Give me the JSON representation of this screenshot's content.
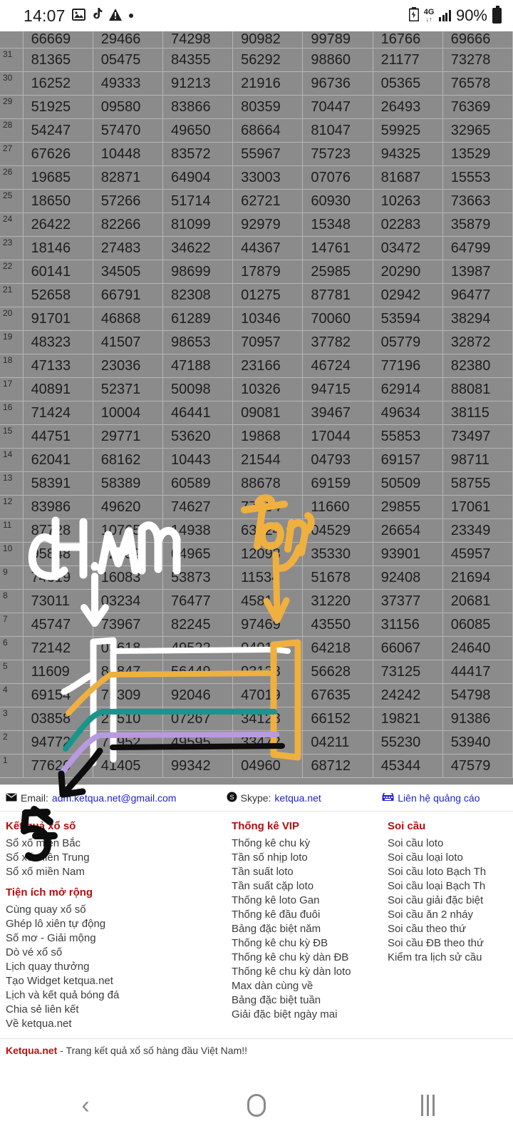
{
  "status_bar": {
    "time": "14:07",
    "icons": [
      "image-icon",
      "tiktok-icon",
      "warning-icon",
      "dot-icon"
    ],
    "battery_saver_icon": "battery-saver-icon",
    "network": "4G",
    "signal_icon": "signal-bars-icon",
    "battery_percent": "90%"
  },
  "table": {
    "columns": 7,
    "rows": [
      {
        "idx": "",
        "values": [
          "66669",
          "29466",
          "74298",
          "90982",
          "99789",
          "16766",
          "69666"
        ],
        "cut": true
      },
      {
        "idx": "31",
        "values": [
          "81365",
          "05475",
          "84355",
          "56292",
          "98860",
          "21177",
          "73278"
        ]
      },
      {
        "idx": "30",
        "values": [
          "16252",
          "49333",
          "91213",
          "21916",
          "96736",
          "05365",
          "76578"
        ]
      },
      {
        "idx": "29",
        "values": [
          "51925",
          "09580",
          "83866",
          "80359",
          "70447",
          "26493",
          "76369"
        ]
      },
      {
        "idx": "28",
        "values": [
          "54247",
          "57470",
          "49650",
          "68664",
          "81047",
          "59925",
          "32965"
        ]
      },
      {
        "idx": "27",
        "values": [
          "67626",
          "10448",
          "83572",
          "55967",
          "75723",
          "94325",
          "13529"
        ]
      },
      {
        "idx": "26",
        "values": [
          "19685",
          "82871",
          "64904",
          "33003",
          "07076",
          "81687",
          "15553"
        ]
      },
      {
        "idx": "25",
        "values": [
          "18650",
          "57266",
          "51714",
          "62721",
          "60930",
          "10263",
          "73663"
        ]
      },
      {
        "idx": "24",
        "values": [
          "26422",
          "82266",
          "81099",
          "92979",
          "15348",
          "02283",
          "35879"
        ]
      },
      {
        "idx": "23",
        "values": [
          "18146",
          "27483",
          "34622",
          "44367",
          "14761",
          "03472",
          "64799"
        ]
      },
      {
        "idx": "22",
        "values": [
          "60141",
          "34505",
          "98699",
          "17879",
          "25985",
          "20290",
          "13987"
        ]
      },
      {
        "idx": "21",
        "values": [
          "52658",
          "66791",
          "82308",
          "01275",
          "87781",
          "02942",
          "96477"
        ]
      },
      {
        "idx": "20",
        "values": [
          "91701",
          "46868",
          "61289",
          "10346",
          "70060",
          "53594",
          "38294"
        ]
      },
      {
        "idx": "19",
        "values": [
          "48323",
          "41507",
          "98653",
          "70957",
          "37782",
          "05779",
          "32872"
        ]
      },
      {
        "idx": "18",
        "values": [
          "47133",
          "23036",
          "47188",
          "23166",
          "46724",
          "77196",
          "82380"
        ]
      },
      {
        "idx": "17",
        "values": [
          "40891",
          "52371",
          "50098",
          "10326",
          "94715",
          "62914",
          "88081"
        ]
      },
      {
        "idx": "16",
        "values": [
          "71424",
          "10004",
          "46441",
          "09081",
          "39467",
          "49634",
          "38115"
        ]
      },
      {
        "idx": "15",
        "values": [
          "44751",
          "29771",
          "53620",
          "19868",
          "17044",
          "55853",
          "73497"
        ]
      },
      {
        "idx": "14",
        "values": [
          "62041",
          "68162",
          "10443",
          "21544",
          "04793",
          "69157",
          "98711"
        ]
      },
      {
        "idx": "13",
        "values": [
          "58391",
          "58389",
          "60589",
          "88678",
          "69159",
          "50509",
          "58755"
        ]
      },
      {
        "idx": "12",
        "values": [
          "83986",
          "49620",
          "74627",
          "77564",
          "11660",
          "29855",
          "17061"
        ]
      },
      {
        "idx": "11",
        "values": [
          "87728",
          "10765",
          "14938",
          "63524",
          "04529",
          "26654",
          "23349"
        ]
      },
      {
        "idx": "10",
        "values": [
          "95848",
          "32159",
          "04965",
          "12093",
          "35330",
          "93901",
          "45957"
        ]
      },
      {
        "idx": "9",
        "values": [
          "74019",
          "16083",
          "53873",
          "11534",
          "51678",
          "92408",
          "21694"
        ]
      },
      {
        "idx": "8",
        "values": [
          "73011",
          "03234",
          "76477",
          "45812",
          "31220",
          "37377",
          "20681"
        ]
      },
      {
        "idx": "7",
        "values": [
          "45747",
          "73967",
          "82245",
          "97469",
          "43550",
          "31156",
          "06085"
        ]
      },
      {
        "idx": "6",
        "values": [
          "72142",
          "03618",
          "49522",
          "04019",
          "64218",
          "66067",
          "24640"
        ]
      },
      {
        "idx": "5",
        "values": [
          "11609",
          "86847",
          "56449",
          "93138",
          "56628",
          "73125",
          "44417"
        ]
      },
      {
        "idx": "4",
        "values": [
          "69154",
          "75309",
          "92046",
          "47019",
          "67635",
          "24242",
          "54798"
        ]
      },
      {
        "idx": "3",
        "values": [
          "03858",
          "29510",
          "07267",
          "34128",
          "66152",
          "19821",
          "91386"
        ]
      },
      {
        "idx": "2",
        "values": [
          "94772",
          "71952",
          "49595",
          "33472",
          "04211",
          "55230",
          "53940"
        ]
      },
      {
        "idx": "1",
        "values": [
          "77626",
          "41405",
          "99342",
          "04960",
          "68712",
          "45344",
          "47579"
        ]
      }
    ]
  },
  "annotations": {
    "cham_label": "CH AM",
    "tong_label": "Tổng",
    "five_label": "5",
    "colors": {
      "white": "#ffffff",
      "orange": "#efb040",
      "teal": "#18968e",
      "purple": "#b89ae0",
      "black": "#0d0d0d"
    }
  },
  "footer": {
    "contacts": [
      {
        "icon": "envelope-icon",
        "label": "Email:",
        "link": "adm.ketqua.net@gmail.com"
      },
      {
        "icon": "skype-icon",
        "label": "Skype:",
        "link": "ketqua.net"
      },
      {
        "icon": "phone-icon",
        "label": "",
        "link": "Liên hệ quảng cáo"
      }
    ],
    "columns": [
      {
        "groups": [
          {
            "heading": "Kết quả xổ số",
            "links": [
              "Sổ xố miền Bắc",
              "Sổ xố miền Trung",
              "Sổ xố miền Nam"
            ]
          },
          {
            "heading": "Tiện ích mở rộng",
            "links": [
              "Cùng quay xổ số",
              "Ghép lô xiên tự động",
              "Số mơ - Giải mộng",
              "Dò vé xổ số",
              "Lịch quay thưởng",
              "Tạo Widget ketqua.net",
              "Lịch và kết quả bóng đá",
              "Chia sẻ liên kết",
              "Về ketqua.net"
            ]
          }
        ]
      },
      {
        "groups": [
          {
            "heading": "Thống kê VIP",
            "links": [
              "Thống kê chu kỳ",
              "Tần số nhịp loto",
              "Tần suất loto",
              "Tần suất cặp loto",
              "Thống kê loto Gan",
              "Thống kê đầu đuôi",
              "Bảng đặc biệt năm",
              "Thống kê chu kỳ ĐB",
              "Thống kê chu kỳ dàn ĐB",
              "Thống kê chu kỳ dàn loto",
              "Max dàn cùng về",
              "Bảng đặc biệt tuần",
              "Giải đặc biệt ngày mai"
            ]
          }
        ]
      },
      {
        "groups": [
          {
            "heading": "Soi cầu",
            "links": [
              "Soi cầu loto",
              "Soi cầu loại loto",
              "Soi cầu loto Bạch Th",
              "Soi cầu loại Bạch Th",
              "Soi cầu giải đặc biệt",
              "Soi cầu ăn 2 nháy",
              "Soi cầu theo thứ",
              "Soi cầu ĐB theo thứ",
              "Kiểm tra lịch sử cầu"
            ]
          }
        ]
      }
    ],
    "tagline_brand": "Ketqua.net",
    "tagline_text": " - Trang kết quả xổ số hàng đầu Việt Nam!!"
  },
  "navbar": {
    "back": "back-button",
    "home": "home-button",
    "recents": "recents-button"
  }
}
